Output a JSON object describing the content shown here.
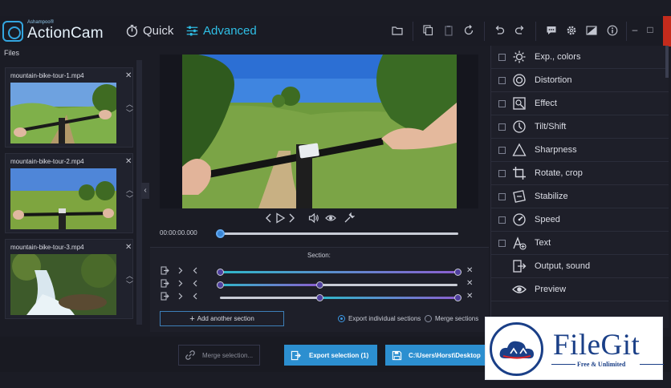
{
  "app": {
    "brand_small": "Ashampoo®",
    "brand": "ActionCam",
    "mode_quick": "Quick",
    "mode_advanced": "Advanced",
    "window_controls": {
      "minimize": "–",
      "maximize": "□"
    }
  },
  "files": {
    "label": "Files",
    "items": [
      {
        "name": "mountain-bike-tour-1.mp4"
      },
      {
        "name": "mountain-bike-tour-2.mp4"
      },
      {
        "name": "mountain-bike-tour-3.mp4"
      }
    ]
  },
  "player": {
    "timecode": "00:00:00.000",
    "position": 0.0
  },
  "section": {
    "label": "Section:",
    "rows": [
      {
        "start": 0.0,
        "end": 1.0,
        "color": "#8b5fd0"
      },
      {
        "start": 0.0,
        "end": 0.42,
        "color": "#8b5fd0"
      },
      {
        "start": 0.42,
        "end": 1.0,
        "color": "#8b5fd0"
      }
    ],
    "add_label": "Add another section",
    "export_individual": "Export individual sections",
    "merge_sections": "Merge sections",
    "selected_option": "export_individual"
  },
  "effects": [
    {
      "label": "Exp., colors",
      "icon": "sun-icon"
    },
    {
      "label": "Distortion",
      "icon": "eye-lens-icon"
    },
    {
      "label": "Effect",
      "icon": "magic-effect-icon"
    },
    {
      "label": "Tilt/Shift",
      "icon": "tilt-shift-icon"
    },
    {
      "label": "Sharpness",
      "icon": "triangle-icon"
    },
    {
      "label": "Rotate, crop",
      "icon": "crop-icon"
    },
    {
      "label": "Stabilize",
      "icon": "stabilize-icon"
    },
    {
      "label": "Speed",
      "icon": "speedometer-icon"
    },
    {
      "label": "Text",
      "icon": "text-icon"
    },
    {
      "label": "Output, sound",
      "icon": "output-icon"
    },
    {
      "label": "Preview",
      "icon": "preview-eye-icon"
    }
  ],
  "export": {
    "merge_label": "Merge selection...",
    "export_label": "Export selection (1)",
    "path_label": "C:\\Users\\Horst\\Desktop"
  },
  "watermark": {
    "title": "FileGit",
    "subtitle": "Free & Unlimited"
  },
  "colors": {
    "accent": "#2fbfe6",
    "button_blue": "#2c8fd0",
    "background": "#1b1c25",
    "track_purple": "#8b5fd0",
    "track_teal": "#2fb7c9"
  }
}
